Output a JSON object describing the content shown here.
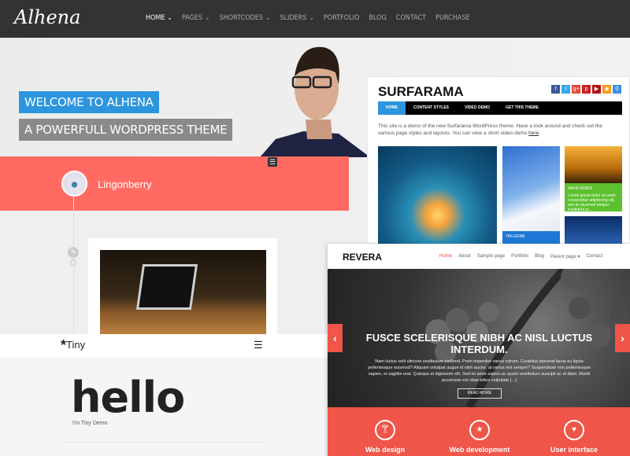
{
  "alhena": {
    "logo": "Alhena",
    "nav": [
      "HOME ⌄",
      "PAGES ⌄",
      "SHORTCODES ⌄",
      "SLIDERS ⌄",
      "PORTFOLIO",
      "BLOG",
      "CONTACT",
      "PURCHASE"
    ],
    "welcome": "WELCOME TO ALHENA",
    "tagline": "A POWERFULL WORDPRESS THEME"
  },
  "surfarama": {
    "title": "SURFARAMA",
    "social": [
      "f",
      "t",
      "g+",
      "p",
      "▶",
      "◉",
      "⚲"
    ],
    "social_colors": [
      "#3b5998",
      "#35a9e8",
      "#dd4b39",
      "#cb2027",
      "#b31217",
      "#f89a1e",
      "#3d8fe0"
    ],
    "nav": [
      "HOME",
      "CONTENT STYLES",
      "VIDEO DEMO",
      "GET THIS THEME"
    ],
    "intro": "This site is a demo of the new Surfarama WordPress theme. Have a look around and check out the various page styles and layouts. You can view a short video demo ",
    "intro_link": "here",
    "tailgrab": "TAILGRAB",
    "wave_rider": "WAVE RIDER",
    "wave_rider_text": "Lorem ipsum dolor sit amet, consectetur adipisicing elit, sed do eiusmod tempor incididunt ut..."
  },
  "lingonberry": {
    "name": "Lingonberry",
    "menu_icon": "☰",
    "pencil_icon": "✎"
  },
  "tiny": {
    "logo_mark": "*",
    "logo": "Tiny",
    "menu_icon": "☰",
    "heading": "hello",
    "subtitle": "I'm Tiny Demo"
  },
  "revera": {
    "logo": "REVERA",
    "nav": [
      "Home",
      "About",
      "Sample page",
      "Portfolio",
      "Blog",
      "Parent page ▾",
      "Contact"
    ],
    "slide_title": "FUSCE SCELERISQUE NIBH AC NISL LUCTUS INTERDUM.",
    "slide_text": "Nam luctus velit ultricies vestibulum eleifend. Proin imperdiet varius rutrum. Curabitur placerat lacus eu ligula pellentesque euismod? Aliquam volutpat augue id nibh auctor, at varius nisi semper? Suspendisse non pellentesque sapien, et sagittis erat. Quisque et dignissim elit. Sed sit amet sapien ac quam vestibulum suscipit ac id diam. Morbi accumsan est vitae tellus vulputate […]",
    "read_more": "READ MORE",
    "prev": "‹",
    "next": "›",
    "features": [
      {
        "icon": "🍸︎",
        "label": "Web design"
      },
      {
        "icon": "★",
        "label": "Web development"
      },
      {
        "icon": "♥",
        "label": "User interface"
      }
    ],
    "accent": "#ef5548"
  }
}
